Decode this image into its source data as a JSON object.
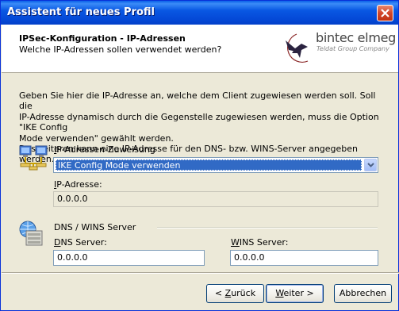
{
  "window": {
    "title": "Assistent für neues Profil"
  },
  "header": {
    "title": "IPSec-Konfiguration - IP-Adressen",
    "subtitle": "Welche IP-Adressen sollen verwendet werden?",
    "logo_main": "bintec elmeg",
    "logo_sub": "Teldat Group Company"
  },
  "description": {
    "line1": "Geben Sie hier die IP-Adresse an, welche dem Client zugewiesen werden soll. Soll die",
    "line2": "IP-Adresse dynamisch durch die Gegenstelle zugewiesen werden, muss die Option \"IKE Config",
    "line3": "Mode verwenden\" gewählt werden.",
    "line4": "Desweiteren kann eine IP-Adresse für den DNS- bzw. WINS-Server angegeben werden."
  },
  "assignment": {
    "label_first": "I",
    "label_rest": "P-Adressen-Zuweisung",
    "selected": "IKE Config Mode verwenden"
  },
  "ip": {
    "label_first": "I",
    "label_rest": "P-Adresse:",
    "value": "0.0.0.0"
  },
  "dns_wins": {
    "group_label": "DNS / WINS Server",
    "dns_label_first": "D",
    "dns_label_rest": "NS Server:",
    "dns_value": "0.0.0.0",
    "wins_label_first": "W",
    "wins_label_rest": "INS Server:",
    "wins_value": "0.0.0.0"
  },
  "buttons": {
    "back_prefix": "< ",
    "back_first": "Z",
    "back_rest": "urück",
    "next_first": "W",
    "next_rest": "eiter >",
    "cancel": "Abbrechen"
  },
  "colors": {
    "titlebar": "#0a5fe8",
    "selection": "#316ac5",
    "close": "#d2462a"
  },
  "icons": [
    "close-icon",
    "logo-bird-icon",
    "network-computers-icon",
    "server-globe-icon",
    "chevron-down-icon"
  ]
}
